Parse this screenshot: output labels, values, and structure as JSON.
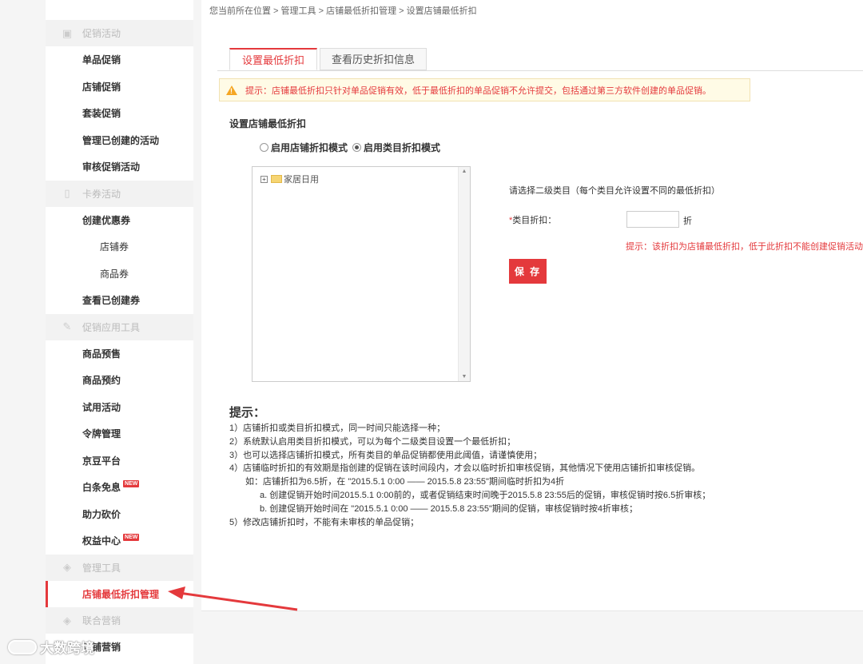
{
  "sidebar": {
    "groups": [
      {
        "header": "促销活动",
        "icon": "calendar-icon",
        "items": [
          {
            "label": "单品促销"
          },
          {
            "label": "店铺促销"
          },
          {
            "label": "套装促销"
          },
          {
            "label": "管理已创建的活动"
          },
          {
            "label": "审核促销活动"
          }
        ]
      },
      {
        "header": "卡券活动",
        "icon": "coupon-icon",
        "items": [
          {
            "label": "创建优惠券"
          },
          {
            "label": "店铺券",
            "sub": true
          },
          {
            "label": "商品券",
            "sub": true
          },
          {
            "label": "查看已创建券"
          }
        ]
      },
      {
        "header": "促销应用工具",
        "icon": "pencil-icon",
        "items": [
          {
            "label": "商品预售"
          },
          {
            "label": "商品预约"
          },
          {
            "label": "试用活动"
          },
          {
            "label": "令牌管理"
          },
          {
            "label": "京豆平台"
          },
          {
            "label": "白条免息",
            "badge": "NEW"
          },
          {
            "label": "助力砍价"
          },
          {
            "label": "权益中心",
            "badge": "NEW"
          }
        ]
      },
      {
        "header": "管理工具",
        "icon": "tag-icon",
        "items": [
          {
            "label": "店铺最低折扣管理",
            "active": true
          }
        ]
      },
      {
        "header": "联合营销",
        "icon": "tag-icon",
        "items": [
          {
            "label": "店铺营销"
          }
        ]
      }
    ]
  },
  "breadcrumb": "您当前所在位置 > 管理工具 > 店铺最低折扣管理 > 设置店铺最低折扣",
  "tabs": [
    {
      "label": "设置最低折扣",
      "active": true
    },
    {
      "label": "查看历史折扣信息",
      "active": false
    }
  ],
  "notice": "提示：店铺最低折扣只针对单品促销有效，低于最低折扣的单品促销不允许提交，包括通过第三方软件创建的单品促销。",
  "form": {
    "section_title": "设置店铺最低折扣",
    "mode_store": "启用店铺折扣模式",
    "mode_category": "启用类目折扣模式",
    "selected_mode": "category",
    "tree_node": "家居日用",
    "select_hint": "请选择二级类目（每个类目允许设置不同的最低折扣）",
    "discount_label": "类目折扣：",
    "required_mark": "*",
    "discount_value": "",
    "discount_unit": "折",
    "discount_tip": "提示：该折扣为店铺最低折扣，低于此折扣不能创建促销活动",
    "save_label": "保 存"
  },
  "tips": {
    "title": "提示：",
    "lines": [
      "1）店铺折扣或类目折扣模式，同一时间只能选择一种；",
      "2）系统默认启用类目折扣模式，可以为每个二级类目设置一个最低折扣；",
      "3）也可以选择店铺折扣模式，所有类目的单品促销都使用此阈值，请谨慎使用；",
      "4）店铺临时折扣的有效期是指创建的促销在该时间段内，才会以临时折扣审核促销，其他情况下使用店铺折扣审核促销。"
    ],
    "example": "如：店铺折扣为6.5折，在 \"2015.5.1 0:00 —— 2015.5.8 23:55\"期间临时折扣为4折",
    "example_a": "a. 创建促销开始时间2015.5.1 0:00前的，或者促销结束时间晚于2015.5.8 23:55后的促销，审核促销时按6.5折审核；",
    "example_b": "b. 创建促销开始时间在 \"2015.5.1 0:00 —— 2015.5.8 23:55\"期间的促销，审核促销时按4折审核；",
    "line5": "5）修改店铺折扣时，不能有未审核的单品促销；"
  },
  "watermark": "大数跨境",
  "colors": {
    "accent": "#e4393c",
    "notice_bg": "#fffbe6"
  }
}
